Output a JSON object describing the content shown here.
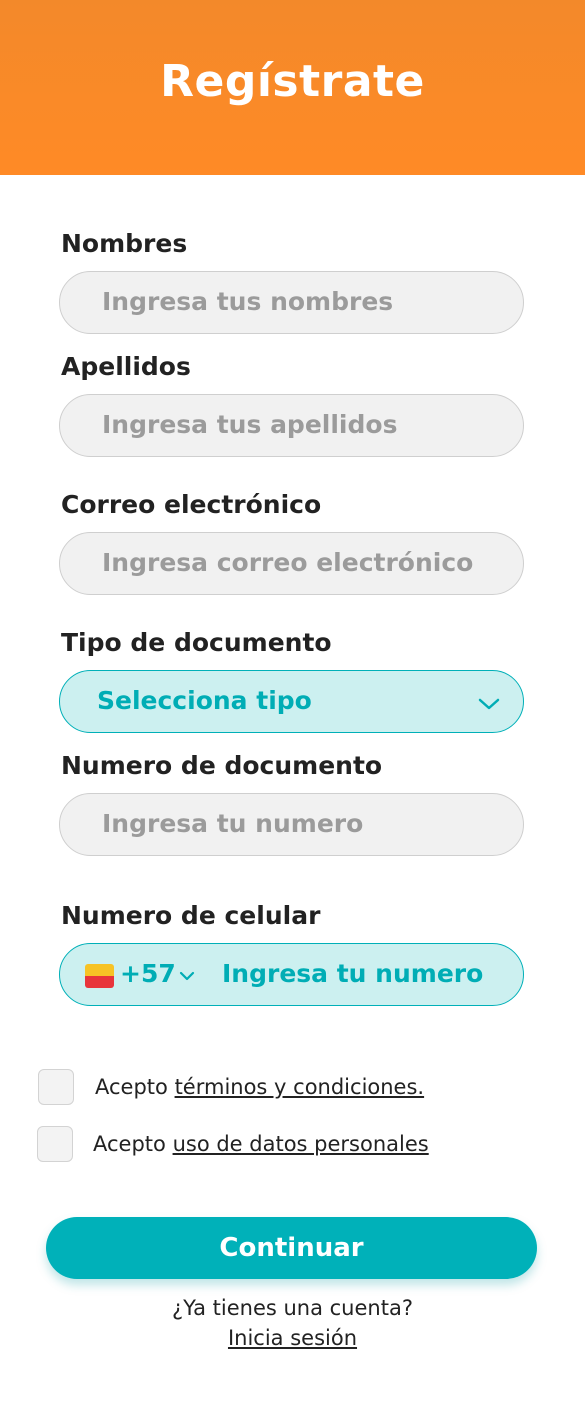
{
  "header": {
    "title": "Regístrate",
    "color": "#FF8A26"
  },
  "form": {
    "nombres": {
      "label": "Nombres",
      "placeholder": "Ingresa tus nombres"
    },
    "apellidos": {
      "label": "Apellidos",
      "placeholder": "Ingresa tus apellidos"
    },
    "correo": {
      "label": "Correo electrónico",
      "placeholder": "Ingresa correo electrónico"
    },
    "tipo_documento": {
      "label": "Tipo de documento",
      "selected": "Selecciona tipo"
    },
    "numero_documento": {
      "label": "Numero de documento",
      "placeholder": "Ingresa tu numero"
    },
    "celular": {
      "label": "Numero de celular",
      "country_code": "+57",
      "placeholder": "Ingresa tu numero",
      "flag_icon": "colombia-flag-icon"
    }
  },
  "checks": {
    "terminos": {
      "prefix": "Acepto ",
      "link": "términos y condiciones."
    },
    "datos": {
      "prefix": "Acepto ",
      "link": "uso de datos personales"
    }
  },
  "actions": {
    "continue_label": "Continuar"
  },
  "footer": {
    "question": "¿Ya tienes una cuenta?",
    "login_link": "Inicia sesión"
  },
  "colors": {
    "accent": "#00B1B9",
    "accent_light": "#CCF0F0",
    "field_bg": "#F1F1F1"
  }
}
